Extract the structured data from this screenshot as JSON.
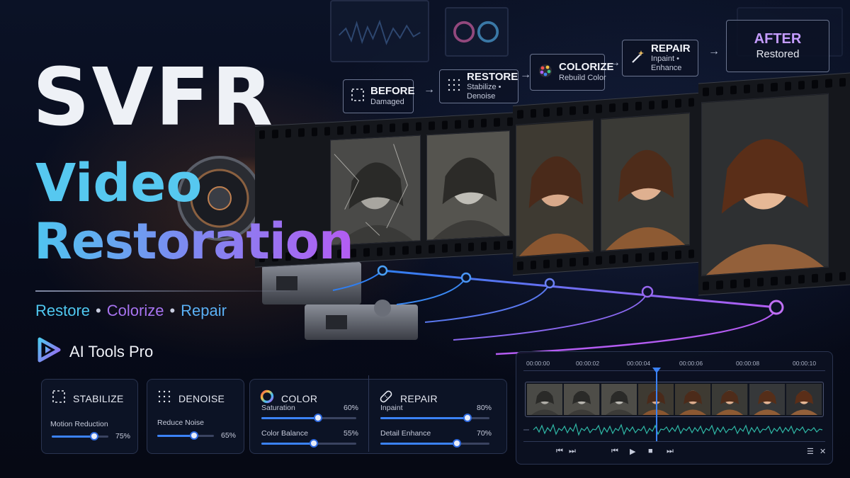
{
  "title": {
    "line1": "SVFR",
    "line2": "Video",
    "line3": "Restoration"
  },
  "tagline": {
    "item1": "Restore",
    "item2": "Colorize",
    "item3": "Repair",
    "separator": "•"
  },
  "brand": {
    "name": "AI Tools Pro",
    "icon": "play-logo-icon"
  },
  "pipeline": [
    {
      "title": "BEFORE",
      "subtitle": "Damaged",
      "icon": "dashed-frame-icon"
    },
    {
      "title": "RESTORE",
      "subtitle": "Stabilize • Denoise",
      "icon": "dot-grid-icon"
    },
    {
      "title": "COLORIZE",
      "subtitle": "Rebuild Color",
      "icon": "color-palette-icon"
    },
    {
      "title": "REPAIR",
      "subtitle": "Inpaint • Enhance",
      "icon": "magic-wand-icon"
    },
    {
      "title": "AFTER",
      "subtitle": "Restored"
    }
  ],
  "arrow": "→",
  "panels": {
    "stabilize": {
      "title": "STABILIZE",
      "icon": "dashed-frame-icon",
      "controls": [
        {
          "label": "Motion Reduction",
          "value": "75%",
          "level": 0.75
        }
      ]
    },
    "denoise": {
      "title": "DENOISE",
      "icon": "dot-grid-icon",
      "controls": [
        {
          "label": "Reduce Noise",
          "value": "65%",
          "level": 0.65
        }
      ]
    },
    "color": {
      "title": "COLOR",
      "icon": "color-wheel-icon",
      "controls": [
        {
          "label": "Saturation",
          "value": "60%",
          "level": 0.6
        },
        {
          "label": "Color Balance",
          "value": "55%",
          "level": 0.55
        }
      ]
    },
    "repair": {
      "title": "REPAIR",
      "icon": "bandage-icon",
      "controls": [
        {
          "label": "Inpaint",
          "value": "80%",
          "level": 0.8
        },
        {
          "label": "Detail Enhance",
          "value": "70%",
          "level": 0.7
        }
      ]
    }
  },
  "timeline": {
    "ticks": [
      "00:00:00",
      "00:00:02",
      "00:00:04",
      "00:00:06",
      "00:00:08",
      "00:00:10"
    ],
    "controls": {
      "prev": "⏮",
      "next": "⏭",
      "start": "⏮",
      "play": "▶",
      "stop": "■",
      "end": "⏭",
      "menu": "☰",
      "close": "✕"
    }
  },
  "colors": {
    "accent": "#3b82f6",
    "cyan": "#4fc8f0",
    "purple": "#a773f0",
    "bg": "#070b1a"
  }
}
